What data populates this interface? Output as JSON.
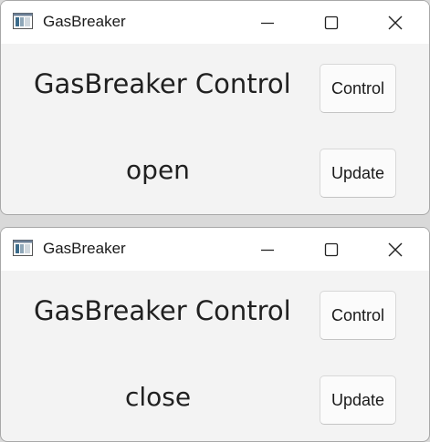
{
  "windows": [
    {
      "title": "GasBreaker",
      "heading": "GasBreaker Control",
      "status": "open",
      "control_label": "Control",
      "update_label": "Update"
    },
    {
      "title": "GasBreaker",
      "heading": "GasBreaker Control",
      "status": "close",
      "control_label": "Control",
      "update_label": "Update"
    }
  ],
  "colors": {
    "titlebar": "#ffffff",
    "client": "#f3f3f3",
    "text": "#202020"
  }
}
